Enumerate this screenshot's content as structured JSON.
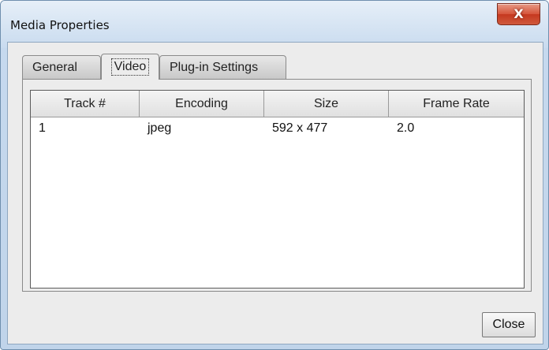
{
  "window": {
    "title": "Media Properties",
    "close_glyph": "X"
  },
  "tabs": [
    {
      "label": "General"
    },
    {
      "label": "Video"
    },
    {
      "label": "Plug-in Settings"
    }
  ],
  "table": {
    "headers": [
      "Track #",
      "Encoding",
      "Size",
      "Frame Rate"
    ],
    "rows": [
      [
        "1",
        "jpeg",
        "592 x 477",
        "2.0"
      ]
    ]
  },
  "buttons": {
    "close_label": "Close"
  }
}
